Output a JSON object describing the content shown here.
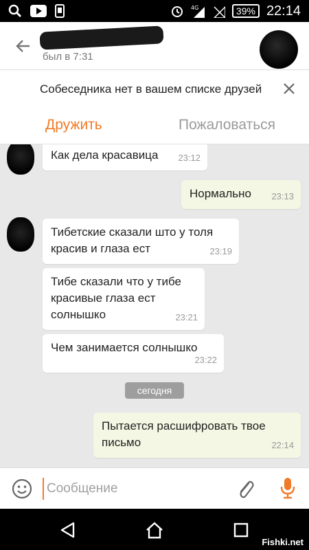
{
  "status_bar": {
    "icons_left": [
      "search-icon",
      "youtube-icon",
      "phone-icon"
    ],
    "network": "4G",
    "battery": "39%",
    "time": "22:14"
  },
  "header": {
    "last_seen": "был в 7:31"
  },
  "banner": {
    "text": "Собеседника нет в вашем списке друзей",
    "friend_label": "Дружить",
    "report_label": "Пожаловаться"
  },
  "messages": [
    {
      "text": "Как дела красавица",
      "time": "23:12",
      "direction": "in"
    },
    {
      "text": "Нормально",
      "time": "23:13",
      "direction": "out"
    },
    {
      "text": "Тибетские сказали што у толя красив и глаза ест",
      "time": "23:19",
      "direction": "in"
    },
    {
      "text": "Тибе сказали что у тибе красивые глаза ест солнышко",
      "time": "23:21",
      "direction": "in"
    },
    {
      "text": "Чем занимается солнышко",
      "time": "23:22",
      "direction": "in"
    }
  ],
  "date_divider": "сегодня",
  "last_message": {
    "text": "Пытается расшифровать твое письмо",
    "time": "22:14",
    "direction": "out"
  },
  "input": {
    "placeholder": "Сообщение",
    "value": ""
  },
  "watermark": "Fishki.net",
  "colors": {
    "accent": "#f07a28",
    "outgoing_bubble": "#f3f7e3",
    "chat_bg": "#e8e8e8"
  }
}
